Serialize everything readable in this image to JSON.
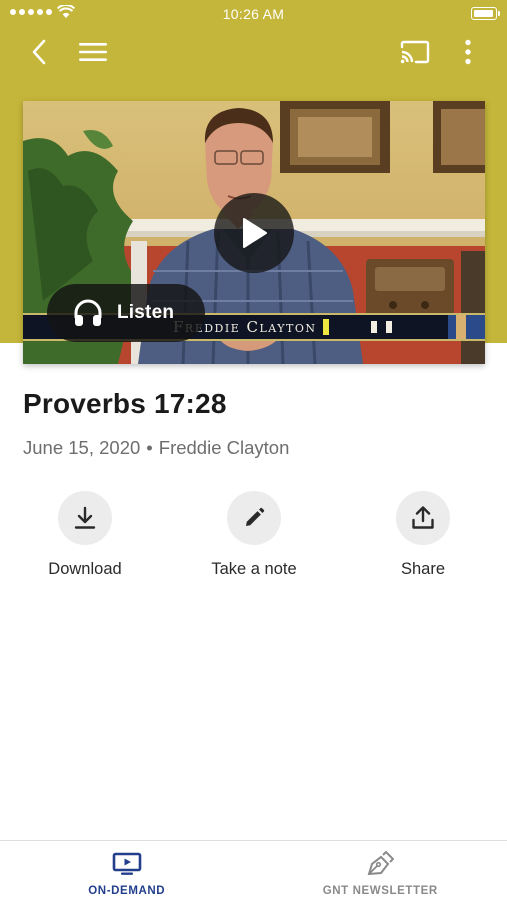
{
  "status_bar": {
    "time": "10:26 AM"
  },
  "nav": {
    "back_icon": "chevron-left-icon",
    "menu_icon": "hamburger-menu-icon",
    "cast_icon": "cast-icon",
    "more_icon": "more-vertical-icon"
  },
  "video": {
    "lower_third": "Freddie Clayton",
    "listen_label": "Listen",
    "play_icon": "play-icon",
    "listen_icon": "headphones-icon"
  },
  "sermon": {
    "title": "Proverbs 17:28",
    "date": "June 15, 2020",
    "separator": "•",
    "speaker": "Freddie Clayton"
  },
  "actions": [
    {
      "label": "Download",
      "icon": "download-icon"
    },
    {
      "label": "Take a note",
      "icon": "pencil-icon"
    },
    {
      "label": "Share",
      "icon": "share-icon"
    }
  ],
  "tabbar": {
    "tabs": [
      {
        "label": "ON-DEMAND",
        "icon": "tv-play-icon",
        "active": true
      },
      {
        "label": "GNT NEWSLETTER",
        "icon": "pen-nib-icon",
        "active": false
      }
    ]
  },
  "colors": {
    "header_background": "#c4b63a",
    "active_tab": "#233f8c",
    "inactive_tab": "#8a8a8a"
  }
}
